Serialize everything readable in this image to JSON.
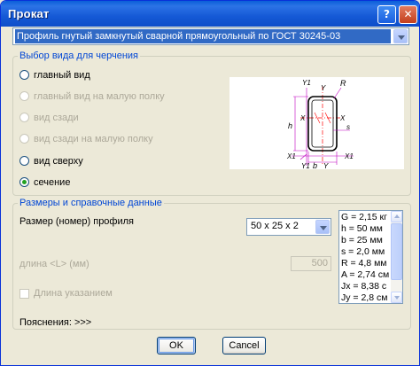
{
  "window": {
    "title": "Прокат",
    "help_label": "?",
    "close_label": "✕"
  },
  "profile_select": {
    "value": "Профиль гнутый замкнутый сварной прямоугольный по ГОСТ 30245-03"
  },
  "view_group": {
    "legend": "Выбор вида для черчения",
    "options": [
      {
        "label": "главный вид",
        "enabled": true,
        "checked": false
      },
      {
        "label": "главный вид на малую полку",
        "enabled": false,
        "checked": false
      },
      {
        "label": "вид сзади",
        "enabled": false,
        "checked": false
      },
      {
        "label": "вид сзади на малую полку",
        "enabled": false,
        "checked": false
      },
      {
        "label": "вид сверху",
        "enabled": true,
        "checked": false
      },
      {
        "label": "сечение",
        "enabled": true,
        "checked": true
      }
    ]
  },
  "diagram": {
    "labels": {
      "y1_top": "Y1",
      "y_top": "Y",
      "r": "R",
      "h": "h",
      "x_left": "X",
      "x_right": "X",
      "s": "s",
      "x1_left": "X1",
      "x1_right": "X1",
      "y1_bottom": "Y1",
      "b": "b",
      "y_bottom": "Y"
    },
    "colors": {
      "outline": "#000000",
      "dims": "#c000c0",
      "axes": "#ff0000"
    }
  },
  "sizes_group": {
    "legend": "Размеры и справочные данные",
    "size_label": "Размер (номер) профиля",
    "size_value": "50 x 25 x 2",
    "length_label": "длина <L> (мм)",
    "length_value": "500",
    "by_length_label": "Длина указанием",
    "notes_label": "Пояснения: >>>",
    "properties": [
      "G = 2,15 кг",
      "h = 50 мм",
      "b = 25 мм",
      "s = 2,0 мм",
      "R = 4,8 мм",
      "A = 2,74 см",
      "Jx = 8,38 с",
      "Jy = 2,8 см"
    ]
  },
  "buttons": {
    "ok": "OK",
    "cancel": "Cancel"
  }
}
